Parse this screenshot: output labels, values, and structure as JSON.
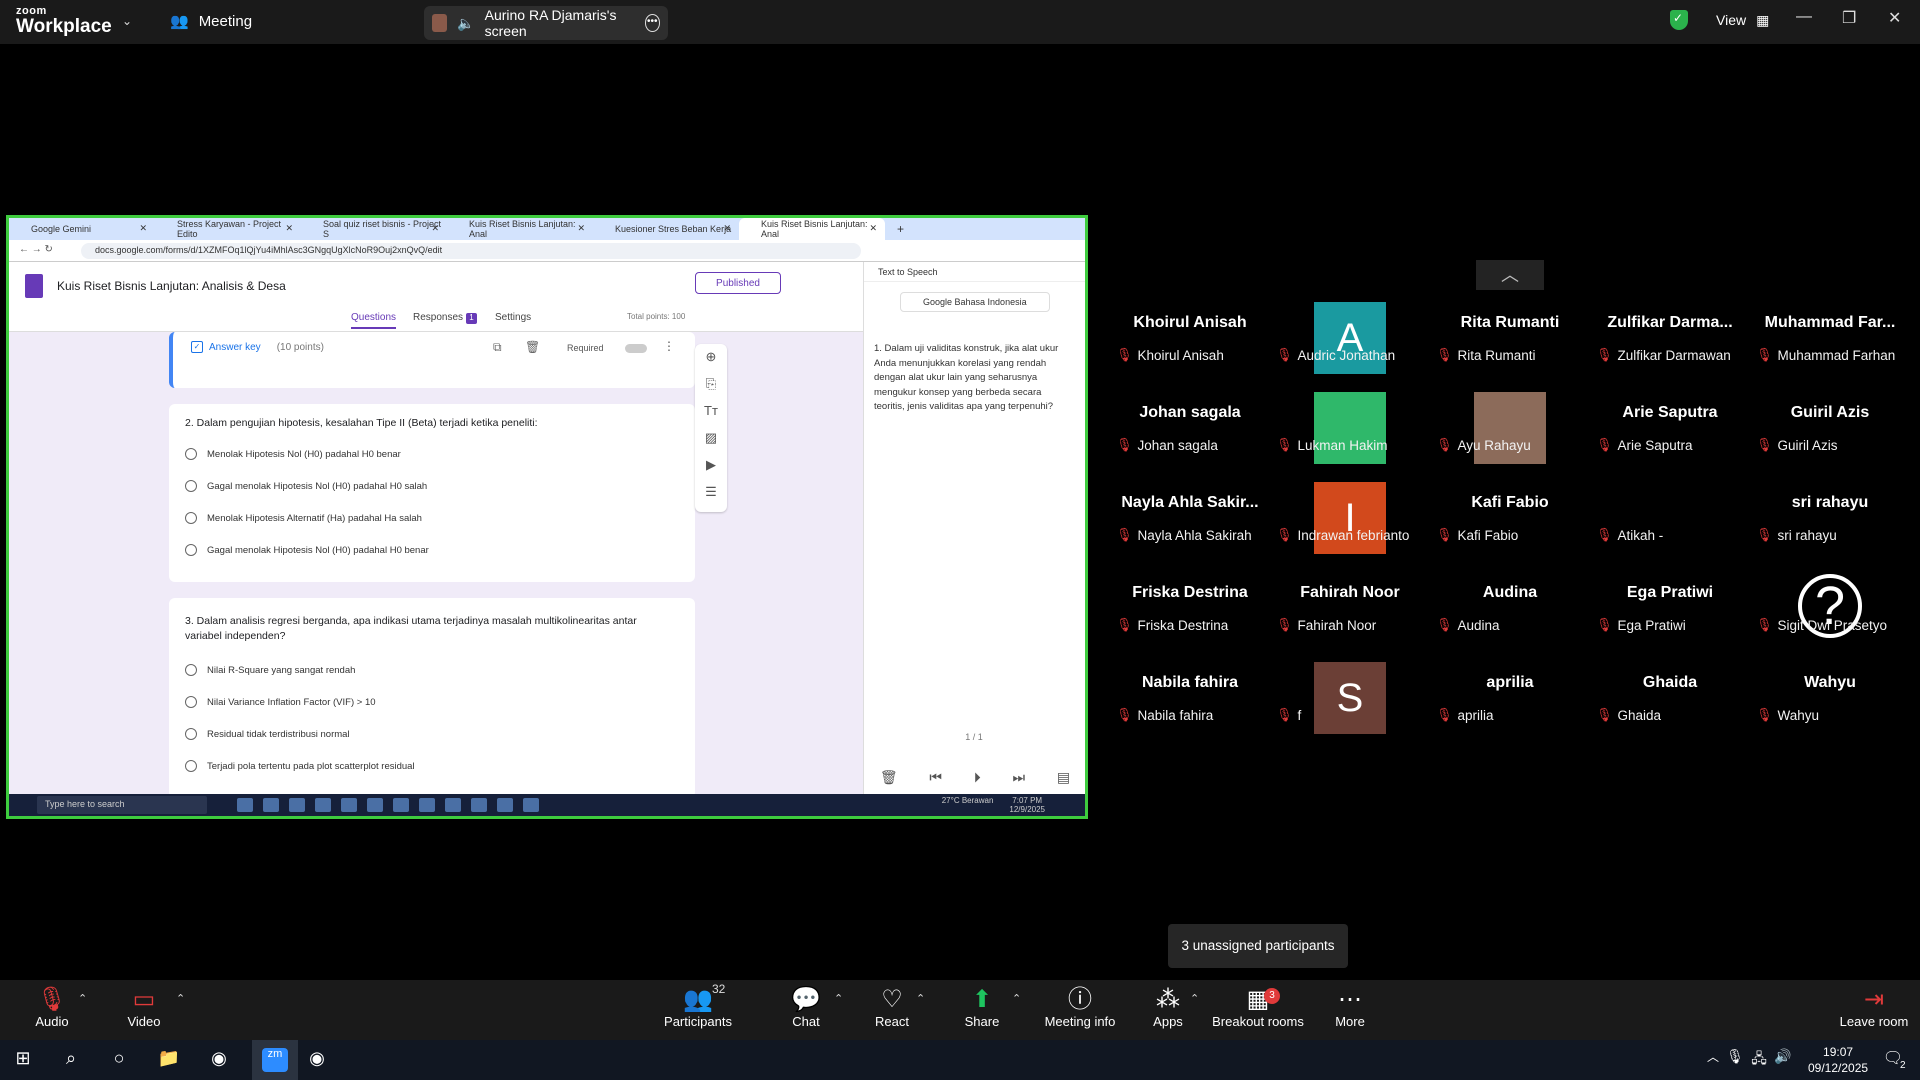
{
  "zoom": {
    "logo_top": "zoom",
    "logo_bottom": "Workplace",
    "meeting_label": "Meeting",
    "screen_share_label": "Aurino RA Djamaris's screen",
    "view_label": "View"
  },
  "browser": {
    "tabs": [
      {
        "label": "Google Gemini"
      },
      {
        "label": "Stress Karyawan - Project Edito"
      },
      {
        "label": "Soal quiz riset bisnis - Project S"
      },
      {
        "label": "Kuis Riset Bisnis Lanjutan: Anal"
      },
      {
        "label": "Kuesioner Stres Beban Kerja"
      },
      {
        "label": "Kuis Riset Bisnis Lanjutan: Anal"
      }
    ],
    "url": "docs.google.com/forms/d/1XZMFOq1lQjYu4iMhlAsc3GNgqUgXlcNoR9Ouj2xnQvQ/edit"
  },
  "forms": {
    "title": "Kuis Riset Bisnis Lanjutan: Analisis & Desa",
    "published_label": "Published",
    "tab_questions": "Questions",
    "tab_responses": "Responses",
    "responses_badge": "1",
    "tab_settings": "Settings",
    "total_points": "Total points: 100",
    "answer_key_label": "Answer key",
    "answer_key_points": "(10 points)",
    "required_label": "Required",
    "q2": {
      "text": "2. Dalam pengujian hipotesis, kesalahan Tipe II (Beta) terjadi ketika peneliti:",
      "options": [
        "Menolak Hipotesis Nol (H0) padahal H0 benar",
        "Gagal menolak Hipotesis Nol (H0) padahal H0 salah",
        "Menolak Hipotesis Alternatif (Ha) padahal Ha salah",
        "Gagal menolak Hipotesis Nol (H0) padahal H0 benar"
      ]
    },
    "q3": {
      "text": "3. Dalam analisis regresi berganda, apa indikasi utama terjadinya masalah multikolinearitas antar variabel independen?",
      "options": [
        "Nilai R-Square yang sangat rendah",
        "Nilai Variance Inflation Factor (VIF) > 10",
        "Residual tidak terdistribusi normal",
        "Terjadi pola tertentu pada plot scatterplot residual"
      ]
    }
  },
  "tts": {
    "title": "Text to Speech",
    "language": "Google Bahasa Indonesia",
    "text": "1. Dalam uji validitas konstruk, jika alat ukur Anda menunjukkan korelasi yang rendah dengan alat ukur lain yang seharusnya mengukur konsep yang berbeda secara teoritis, jenis validitas apa yang terpenuhi?",
    "page_current": "1",
    "page_total": "/ 1"
  },
  "inner_taskbar": {
    "search_placeholder": "Type here to search",
    "weather": "27°C Berawan",
    "time": "7:07 PM",
    "date": "12/9/2025"
  },
  "participants_tiles": [
    {
      "big": "Khoirul Anisah",
      "name": "Khoirul Anisah"
    },
    {
      "big": "A",
      "name": "Audric Jonathan",
      "avatar_color": "#1a9aa0"
    },
    {
      "big": "Rita Rumanti",
      "name": "Rita Rumanti"
    },
    {
      "big": "Zulfikar Darma...",
      "name": "Zulfikar Darmawan"
    },
    {
      "big": "Muhammad Far...",
      "name": "Muhammad Farhan"
    },
    {
      "big": "Johan sagala",
      "name": "Johan sagala"
    },
    {
      "big": "",
      "name": "Lukman Hakim",
      "avatar_color": "#2fb86a"
    },
    {
      "big": "",
      "name": "Ayu Rahayu",
      "avatar_color": "#8c6b5a"
    },
    {
      "big": "Arie Saputra",
      "name": "Arie Saputra"
    },
    {
      "big": "Guiril Azis",
      "name": "Guiril Azis"
    },
    {
      "big": "Nayla Ahla Sakir...",
      "name": "Nayla Ahla Sakirah"
    },
    {
      "big": "I",
      "name": "Indrawan febrianto",
      "avatar_color": "#d2491c"
    },
    {
      "big": "Kafi Fabio",
      "name": "Kafi Fabio"
    },
    {
      "big": "",
      "name": "Atikah -",
      "avatar_color": "#000000"
    },
    {
      "big": "sri rahayu",
      "name": "sri rahayu"
    },
    {
      "big": "Friska Destrina",
      "name": "Friska Destrina"
    },
    {
      "big": "Fahirah Noor",
      "name": "Fahirah Noor"
    },
    {
      "big": "Audina",
      "name": "Audina"
    },
    {
      "big": "Ega Pratiwi",
      "name": "Ega Pratiwi"
    },
    {
      "big": "?",
      "name": "Sigit Dwi Prasetyo",
      "avatar_color": "#000000"
    },
    {
      "big": "Nabila fahira",
      "name": "Nabila fahira"
    },
    {
      "big": "S",
      "name": "f",
      "avatar_color": "#6b3f36"
    },
    {
      "big": "aprilia",
      "name": "aprilia"
    },
    {
      "big": "Ghaida",
      "name": "Ghaida"
    },
    {
      "big": "Wahyu",
      "name": "Wahyu"
    }
  ],
  "unassigned_label": "3 unassigned participants",
  "toolbar": {
    "audio": "Audio",
    "video": "Video",
    "participants": "Participants",
    "participants_count": "32",
    "chat": "Chat",
    "react": "React",
    "share": "Share",
    "meeting_info": "Meeting info",
    "apps": "Apps",
    "breakout": "Breakout rooms",
    "breakout_badge": "3",
    "more": "More",
    "leave": "Leave room"
  },
  "clock": {
    "time": "19:07",
    "date": "09/12/2025"
  },
  "notification_count": "2",
  "colors": {
    "share_border": "#3ecc3e",
    "mic_off": "#e03a3a",
    "share_green": "#1ec45f",
    "forms_purple": "#673ab7"
  }
}
